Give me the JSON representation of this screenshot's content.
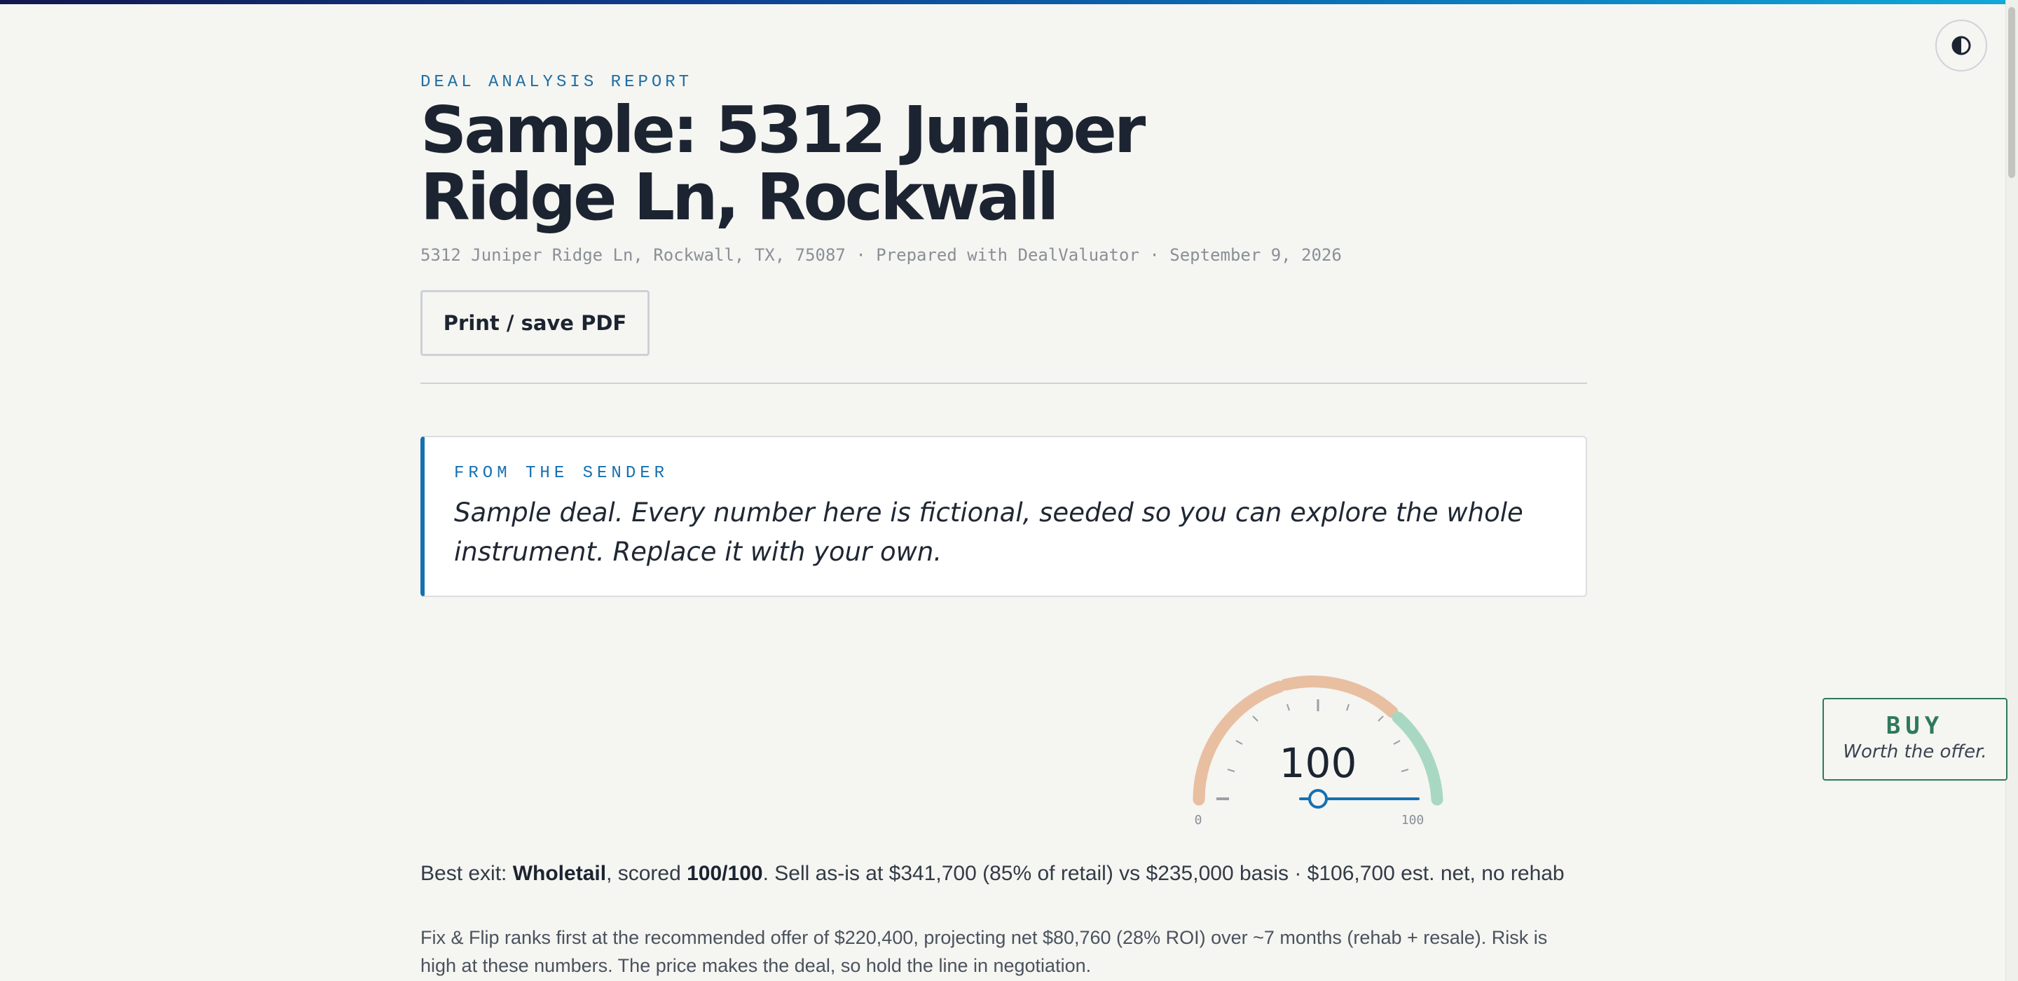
{
  "report": {
    "eyebrow": "DEAL ANALYSIS REPORT",
    "title": "Sample: 5312 Juniper Ridge Ln, Rockwall",
    "meta": "5312 Juniper Ridge Ln, Rockwall, TX, 75087 · Prepared with DealValuator · September 9, 2026",
    "print_label": "Print / save PDF"
  },
  "sender_note": {
    "label": "FROM THE SENDER",
    "text": "Sample deal. Every number here is fictional, seeded so you can explore the whole instrument. Replace it with your own."
  },
  "score": {
    "value": "100",
    "scale_min": "0",
    "scale_max": "100",
    "fraction": 1.0
  },
  "verdict": {
    "label": "BUY",
    "sub": "Worth the offer."
  },
  "best_exit": {
    "prefix": "Best exit: ",
    "strategy": "Wholetail",
    "mid": ", scored ",
    "score": "100/100",
    "rest": ". Sell as-is at $341,700 (85% of retail) vs $235,000 basis · $106,700 est. net, no rehab"
  },
  "summary": "Fix & Flip ranks first at the recommended offer of $220,400, projecting net $80,760 (28% ROI) over ~7 months (rehab + resale). Risk is high at these numbers. The price makes the deal, so hold the line in negotiation.",
  "colors": {
    "accent": "#1670b0",
    "gauge_warm": "#e9bfa1",
    "gauge_good": "#a9d8c2",
    "verdict": "#2d7a5b"
  }
}
